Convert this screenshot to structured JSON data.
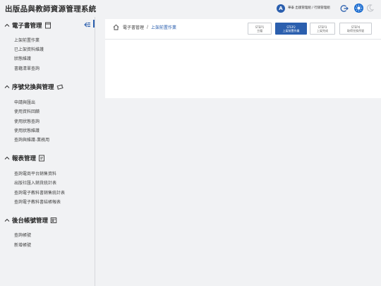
{
  "header": {
    "app_title": "出版品與教師資源管理系統",
    "user_initial": "A",
    "user_info": "華泰 出版管理組 / 行銷管理組",
    "icons": [
      "logout-icon",
      "theme-light-icon",
      "theme-dark-icon"
    ],
    "accent_color": "#2b5fae"
  },
  "sidebar": {
    "sections": [
      {
        "title": "電子書管理",
        "icon": "book-icon",
        "items": [
          "上架前置作業",
          "已上架資料維護",
          "狀態維護",
          "書籍清單查詢"
        ]
      },
      {
        "title": "序號兌換與管理",
        "icon": "ticket-icon",
        "items": [
          "申請與匯出",
          "使用資料回饋",
          "使用狀態查詢",
          "使用狀態維護",
          "查詢與維護-業務用"
        ]
      },
      {
        "title": "報表管理",
        "icon": "report-icon",
        "items": [
          "查詢電商平台銷售資料",
          "出版社匯入銷貨統計表",
          "查詢電子教科書銷售統計表",
          "查詢電子教科書結帳報表"
        ]
      },
      {
        "title": "後台帳號管理",
        "icon": "account-icon",
        "items": [
          "查詢帳號",
          "新增帳號"
        ]
      }
    ]
  },
  "breadcrumb": {
    "items": [
      "電子書管理",
      "上架前置作業"
    ],
    "separator": "/"
  },
  "steps": [
    {
      "line1": "STEP1",
      "line2": "主檔",
      "active": false
    },
    {
      "line1": "STEP2",
      "line2": "上架前置作業",
      "active": true
    },
    {
      "line1": "STEP3",
      "line2": "上架完成",
      "active": false
    },
    {
      "line1": "STEP4",
      "line2": "取得兌換序號",
      "active": false
    }
  ]
}
